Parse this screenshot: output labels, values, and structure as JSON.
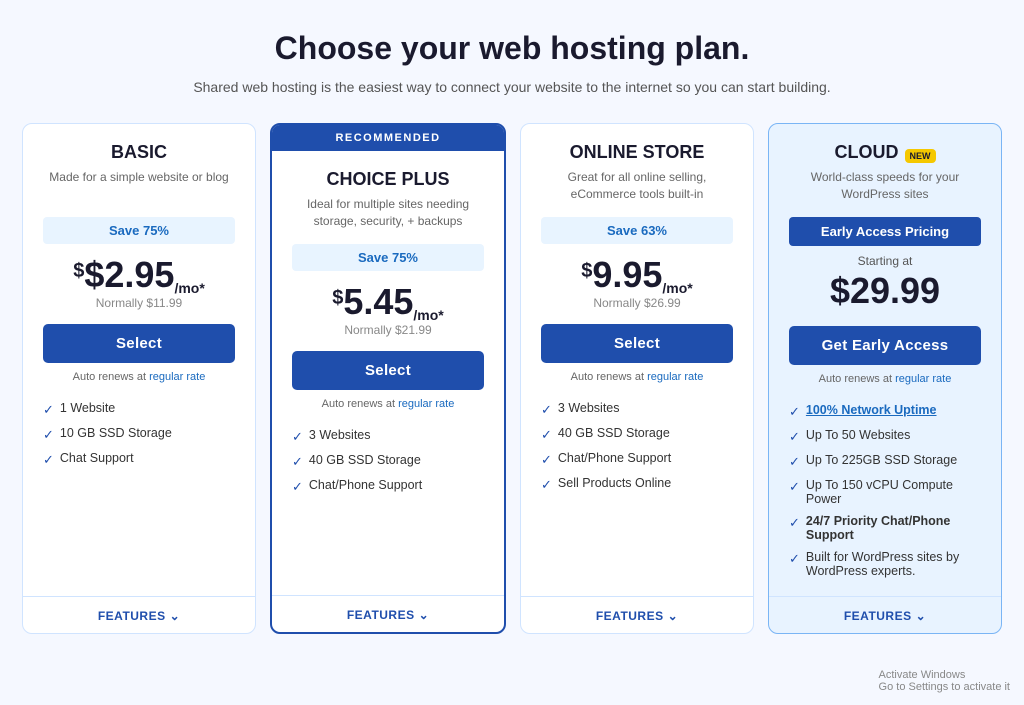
{
  "header": {
    "title": "Choose your web hosting plan.",
    "subtitle": "Shared web hosting is the easiest way to connect your website to the internet so you can start building."
  },
  "plans": [
    {
      "id": "basic",
      "name": "BASIC",
      "recommended": false,
      "cloud": false,
      "desc": "Made for a simple website or blog",
      "save": "Save 75%",
      "price_dollar": "$2.95",
      "price_unit": "/mo*",
      "price_normal": "Normally $11.99",
      "select_label": "Select",
      "auto_renew": "Auto renews at regular rate",
      "features": [
        "1 Website",
        "10 GB SSD Storage",
        "Chat Support"
      ],
      "features_link": null,
      "footer_label": "FEATURES"
    },
    {
      "id": "choice-plus",
      "name": "CHOICE PLUS",
      "recommended": true,
      "cloud": false,
      "desc": "Ideal for multiple sites needing storage, security, + backups",
      "save": "Save 75%",
      "price_dollar": "$5.45",
      "price_unit": "/mo*",
      "price_normal": "Normally $21.99",
      "select_label": "Select",
      "auto_renew": "Auto renews at regular rate",
      "features": [
        "3 Websites",
        "40 GB SSD Storage",
        "Chat/Phone Support"
      ],
      "footer_label": "FEATURES"
    },
    {
      "id": "online-store",
      "name": "ONLINE STORE",
      "recommended": false,
      "cloud": false,
      "desc": "Great for all online selling, eCommerce tools built-in",
      "save": "Save 63%",
      "price_dollar": "$9.95",
      "price_unit": "/mo*",
      "price_normal": "Normally $26.99",
      "select_label": "Select",
      "auto_renew": "Auto renews at regular rate",
      "features": [
        "3 Websites",
        "40 GB SSD Storage",
        "Chat/Phone Support",
        "Sell Products Online"
      ],
      "footer_label": "FEATURES"
    },
    {
      "id": "cloud",
      "name": "CLOUD",
      "new_badge": "NEW",
      "recommended": false,
      "cloud": true,
      "desc": "World-class speeds for your WordPress sites",
      "early_access": "Early Access Pricing",
      "starting_at": "Starting at",
      "price_cloud": "$29.99",
      "select_label": "Get Early Access",
      "auto_renew": "Auto renews at regular rate",
      "features": [
        {
          "text": "100% Network Uptime",
          "link": true,
          "bold": false
        },
        {
          "text": "Up To 50 Websites",
          "link": false,
          "bold": false
        },
        {
          "text": "Up To 225GB SSD Storage",
          "link": false,
          "bold": false
        },
        {
          "text": "Up To 150 vCPU Compute Power",
          "link": false,
          "bold": false
        },
        {
          "text": "24/7 Priority Chat/Phone Support",
          "link": false,
          "bold": true
        },
        {
          "text": "Built for WordPress sites by WordPress experts.",
          "link": false,
          "bold": false
        }
      ],
      "footer_label": "FEATURES"
    }
  ],
  "recommended_badge": "RECOMMENDED",
  "activate_line1": "Activate Windows",
  "activate_line2": "Go to Settings to activate it"
}
